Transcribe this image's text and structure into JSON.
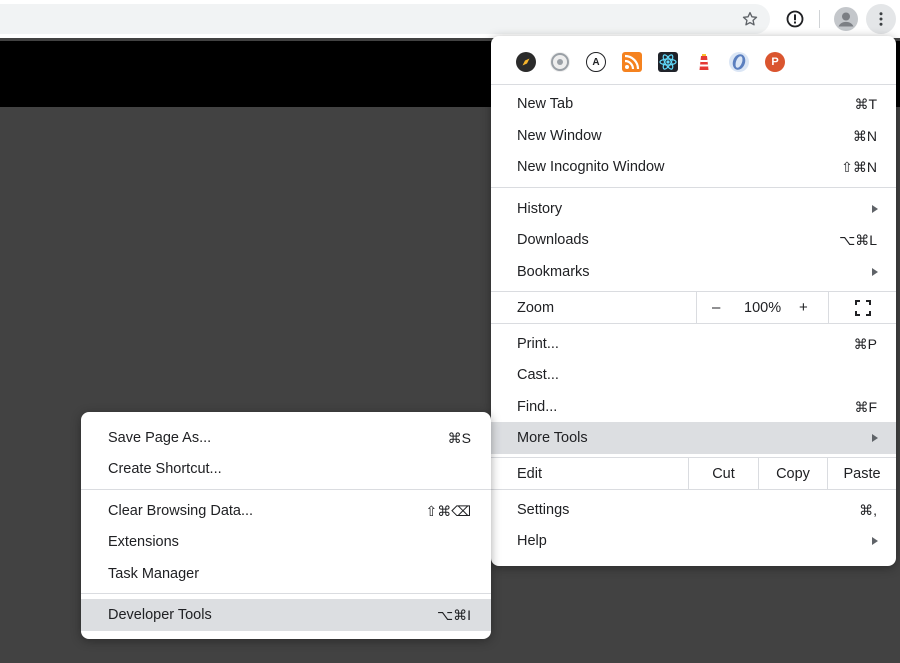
{
  "toolbar": {
    "icons": [
      "star-icon",
      "extension-info-icon",
      "profile-avatar-icon",
      "more-vert-icon"
    ]
  },
  "main_menu": {
    "extensions": [
      {
        "name": "compass-extension-icon",
        "color": "#2b2b2b"
      },
      {
        "name": "gear-extension-icon",
        "color": "#d6d6d6"
      },
      {
        "name": "a-circle-extension-icon",
        "color": "#ffffff"
      },
      {
        "name": "rss-extension-icon",
        "color": "#f5821f"
      },
      {
        "name": "react-extension-icon",
        "color": "#20232a"
      },
      {
        "name": "lighthouse-extension-icon",
        "color": "#e53935"
      },
      {
        "name": "oval-extension-icon",
        "color": "#5b7fbf"
      },
      {
        "name": "producthunt-extension-icon",
        "color": "#da552f"
      }
    ],
    "new_tab": {
      "label": "New Tab",
      "shortcut": "⌘T"
    },
    "new_window": {
      "label": "New Window",
      "shortcut": "⌘N"
    },
    "new_incognito": {
      "label": "New Incognito Window",
      "shortcut": "⇧⌘N"
    },
    "history": {
      "label": "History"
    },
    "downloads": {
      "label": "Downloads",
      "shortcut": "⌥⌘L"
    },
    "bookmarks": {
      "label": "Bookmarks"
    },
    "zoom": {
      "label": "Zoom",
      "minus": "–",
      "value": "100%",
      "plus": "+"
    },
    "print": {
      "label": "Print...",
      "shortcut": "⌘P"
    },
    "cast": {
      "label": "Cast..."
    },
    "find": {
      "label": "Find...",
      "shortcut": "⌘F"
    },
    "more_tools": {
      "label": "More Tools"
    },
    "edit": {
      "label": "Edit",
      "cut": "Cut",
      "copy": "Copy",
      "paste": "Paste"
    },
    "settings": {
      "label": "Settings",
      "shortcut": "⌘,"
    },
    "help": {
      "label": "Help"
    }
  },
  "sub_menu": {
    "save_page": {
      "label": "Save Page As...",
      "shortcut": "⌘S"
    },
    "create_shortcut": {
      "label": "Create Shortcut..."
    },
    "clear_data": {
      "label": "Clear Browsing Data...",
      "shortcut": "⇧⌘⌫"
    },
    "extensions": {
      "label": "Extensions"
    },
    "task_manager": {
      "label": "Task Manager"
    },
    "dev_tools": {
      "label": "Developer Tools",
      "shortcut": "⌥⌘I"
    }
  },
  "colors": {
    "page_background": "#424242",
    "highlight": "#dcdee1"
  }
}
